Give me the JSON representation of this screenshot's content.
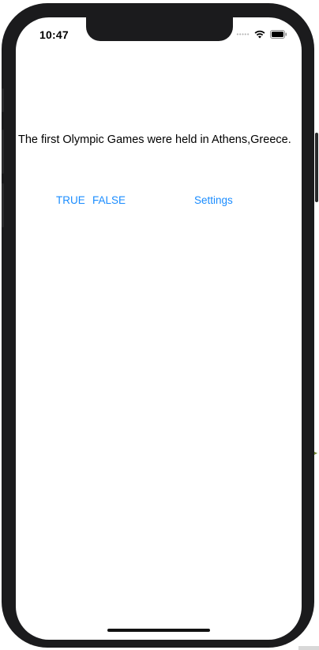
{
  "status_bar": {
    "time": "10:47",
    "signal_icon": "signal-dots-icon",
    "wifi_icon": "wifi-icon",
    "battery_icon": "battery-icon"
  },
  "question": {
    "text": "The first Olympic Games were held  in Athens,Greece."
  },
  "buttons": {
    "true_label": "TRUE",
    "false_label": "FALSE",
    "settings_label": "Settings"
  },
  "colors": {
    "accent": "#1a8cff",
    "text": "#000000",
    "frame": "#1b1b1d",
    "screen": "#ffffff"
  }
}
